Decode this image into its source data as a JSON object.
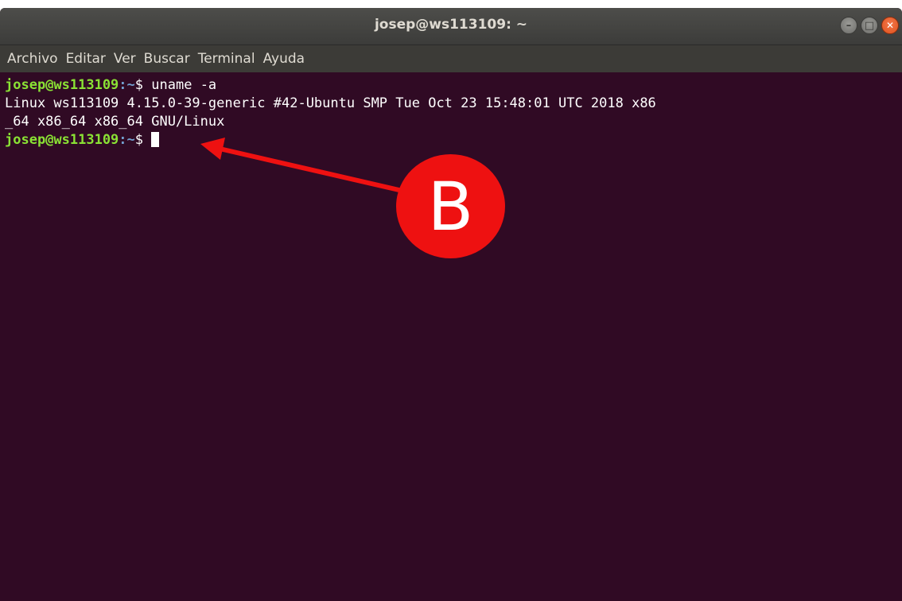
{
  "window": {
    "title": "josep@ws113109: ~"
  },
  "menu": {
    "items": [
      "Archivo",
      "Editar",
      "Ver",
      "Buscar",
      "Terminal",
      "Ayuda"
    ]
  },
  "terminal": {
    "prompt_user": "josep@ws113109",
    "prompt_colon": ":",
    "prompt_path": "~",
    "prompt_sign": "$ ",
    "command": "uname -a",
    "output_line_1": "Linux ws113109 4.15.0-39-generic #42-Ubuntu SMP Tue Oct 23 15:48:01 UTC 2018 x86",
    "output_line_2": "_64 x86_64 x86_64 GNU/Linux"
  },
  "annotation": {
    "label": "B",
    "color": "#ee1111"
  },
  "colors": {
    "terminal_bg": "#300a24",
    "prompt_user": "#8ae234",
    "prompt_path": "#729fcf",
    "close_button": "#e95420"
  },
  "icons": {
    "minimize": "minimize-icon",
    "maximize": "maximize-icon",
    "close": "close-icon",
    "arrow": "arrow-icon"
  }
}
